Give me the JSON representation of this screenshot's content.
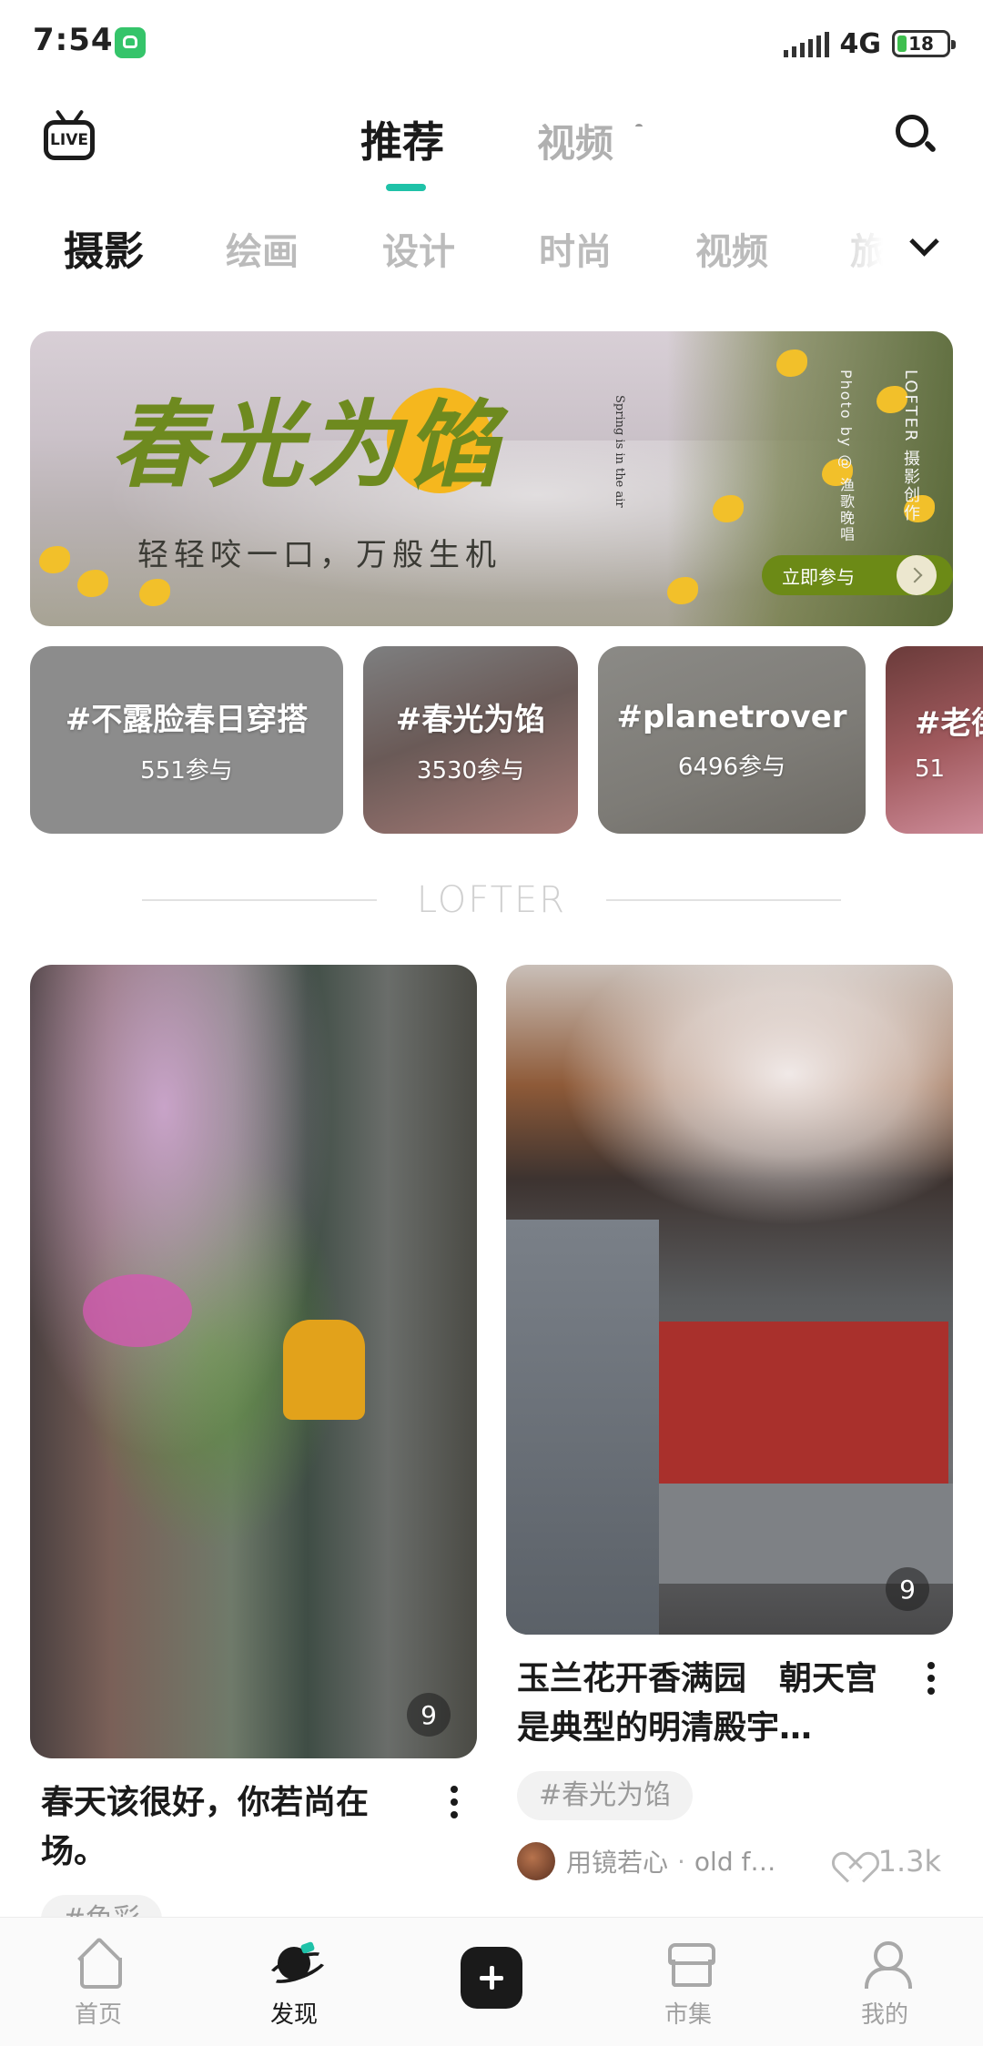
{
  "status_bar": {
    "time": "7:54",
    "network": "4G",
    "battery": "18",
    "battery_color": "#3fbf4f",
    "app_indicator_color": "#35c46a"
  },
  "header": {
    "live_label": "LIVE",
    "tabs": [
      {
        "label": "推荐",
        "active": true
      },
      {
        "label": "视频",
        "active": false
      }
    ],
    "accent_color": "#1fc2a8",
    "search_icon": "search-icon"
  },
  "categories": {
    "items": [
      "摄影",
      "绘画",
      "设计",
      "时尚",
      "视频",
      "旅"
    ],
    "active_index": 0
  },
  "banner": {
    "title": "春光为馅",
    "subtitle": "轻轻咬一口，万般生机",
    "english": "Spring is in the air",
    "vertical_brand": "LOFTER 摄影创作",
    "vertical_credit": "Photo by @ 渔歌晚唱",
    "cta": "立即参与",
    "cta_color": "#6c8a16"
  },
  "topics": [
    {
      "name": "#不露脸春日穿搭",
      "count": "551参与"
    },
    {
      "name": "#春光为馅",
      "count": "3530参与"
    },
    {
      "name": "#planetrover",
      "count": "6496参与"
    },
    {
      "name": "#老街",
      "count": "51"
    }
  ],
  "divider": {
    "logo": "LOFTER"
  },
  "feed": {
    "left": {
      "image_count": "9",
      "title": "春天该很好，你若尚在场。",
      "tag": "#色彩"
    },
    "right": {
      "image_count": "9",
      "title": "玉兰花开香满园　朝天宫是典型的明清殿宇…",
      "tag": "#春光为馅",
      "author_name": "用镜若心",
      "author_separator": "·",
      "author_handle": "old f…",
      "likes": "1.3k"
    }
  },
  "bottom_nav": {
    "items": [
      {
        "label": "首页",
        "icon": "home-icon",
        "active": false
      },
      {
        "label": "发现",
        "icon": "planet-icon",
        "active": true
      },
      {
        "label": "",
        "icon": "plus-icon",
        "active": false
      },
      {
        "label": "市集",
        "icon": "store-icon",
        "active": false
      },
      {
        "label": "我的",
        "icon": "person-icon",
        "active": false
      }
    ]
  }
}
